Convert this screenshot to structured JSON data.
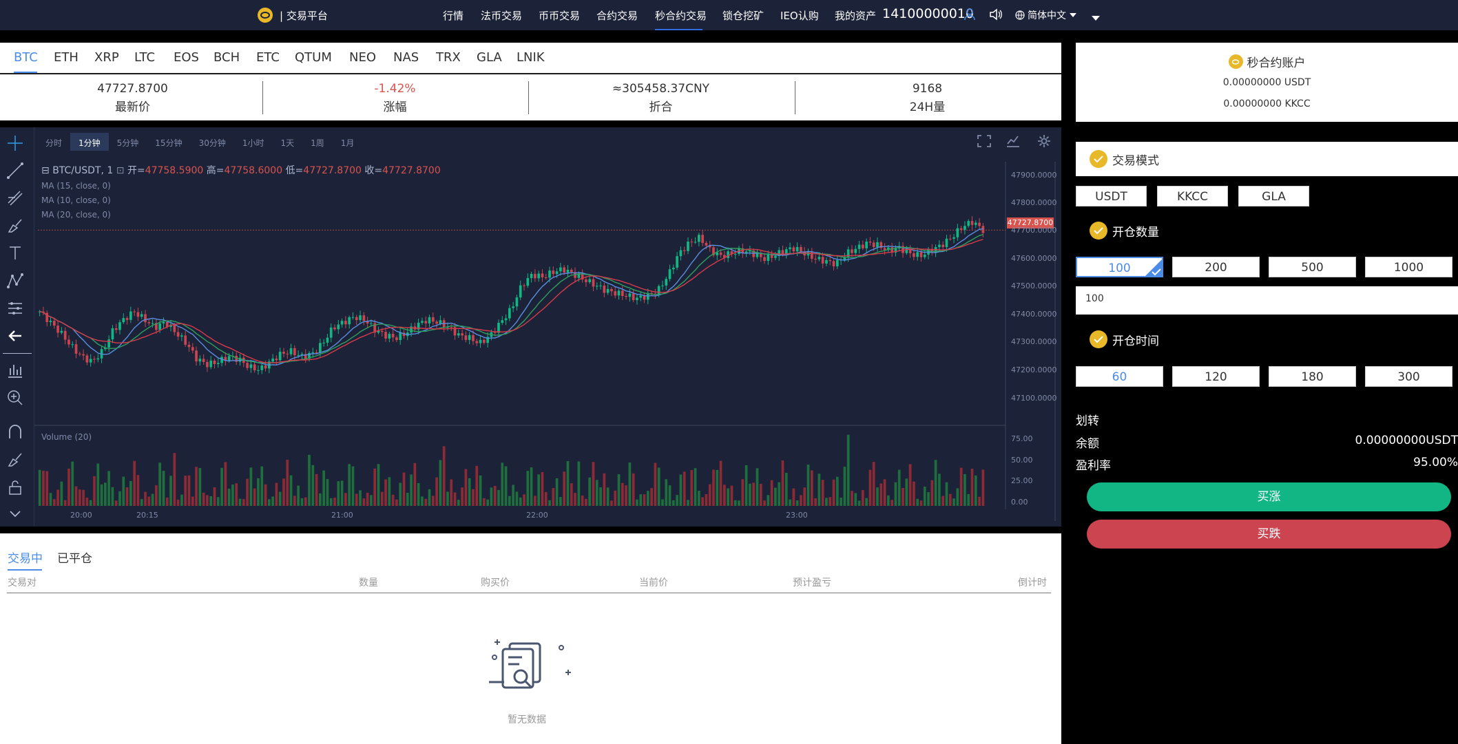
{
  "nav": {
    "brand": "| 交易平台",
    "items": [
      "行情",
      "法币交易",
      "币币交易",
      "合约交易",
      "秒合约交易",
      "锁仓挖矿",
      "IEO认购",
      "我的资产"
    ],
    "active": "秒合约交易",
    "account": "14100000010",
    "language": "简体中文"
  },
  "coins": {
    "tabs": [
      "BTC",
      "ETH",
      "XRP",
      "LTC",
      "EOS",
      "BCH",
      "ETC",
      "QTUM",
      "NEO",
      "NAS",
      "TRX",
      "GLA",
      "LNIK"
    ],
    "active": "BTC"
  },
  "stats": [
    {
      "value": "47727.8700",
      "label": "最新价"
    },
    {
      "value": "-1.42%",
      "label": "涨幅"
    },
    {
      "value": "≈305458.37CNY",
      "label": "折合"
    },
    {
      "value": "9168",
      "label": "24H量"
    }
  ],
  "chart": {
    "intervals": [
      "分时",
      "1分钟",
      "5分钟",
      "15分钟",
      "30分钟",
      "1小时",
      "1天",
      "1周",
      "1月"
    ],
    "active_interval": "1分钟",
    "symbol": "BTC/USDT, 1",
    "open_label": "开=",
    "open": "47758.5900",
    "high_label": "高=",
    "high": "47758.6000",
    "low_label": "低=",
    "low": "47727.8700",
    "close_label": "收=",
    "close": "47727.8700",
    "ma": [
      "MA (15, close, 0)",
      "MA (10, close, 0)",
      "MA (20, close, 0)"
    ],
    "volume_label": "Volume (20)",
    "last_price_tag": "47727.8700",
    "price_ticks": [
      "47900.0000",
      "47800.0000",
      "47700.0000",
      "47600.0000",
      "47500.0000",
      "47400.0000",
      "47300.0000",
      "47200.0000",
      "47100.0000"
    ],
    "volume_ticks": [
      "75.00",
      "50.00",
      "25.00",
      "0.00"
    ],
    "time_ticks": [
      "20:00",
      "20:15",
      "21:00",
      "22:00",
      "23:00"
    ]
  },
  "chart_data": {
    "type": "candlestick",
    "title": "BTC/USDT, 1",
    "ylim": [
      47050,
      47960
    ],
    "x_labels": [
      "20:00",
      "20:15",
      "21:00",
      "22:00",
      "23:00"
    ],
    "close_series": [
      47420,
      47380,
      47340,
      47290,
      47250,
      47230,
      47270,
      47350,
      47390,
      47420,
      47390,
      47360,
      47380,
      47340,
      47300,
      47240,
      47220,
      47230,
      47250,
      47240,
      47210,
      47200,
      47230,
      47260,
      47270,
      47250,
      47260,
      47300,
      47360,
      47380,
      47400,
      47390,
      47350,
      47330,
      47320,
      47340,
      47370,
      47390,
      47380,
      47360,
      47330,
      47320,
      47300,
      47330,
      47380,
      47430,
      47520,
      47560,
      47550,
      47570,
      47580,
      47560,
      47540,
      47520,
      47500,
      47490,
      47480,
      47470,
      47480,
      47500,
      47560,
      47640,
      47680,
      47700,
      47650,
      47630,
      47640,
      47650,
      47640,
      47620,
      47630,
      47650,
      47660,
      47640,
      47620,
      47610,
      47600,
      47640,
      47660,
      47680,
      47670,
      47650,
      47660,
      47640,
      47630,
      47650,
      47670,
      47700,
      47740,
      47760,
      47727.87
    ],
    "volume_max": 75
  },
  "orders": {
    "tabs": [
      "交易中",
      "已平仓"
    ],
    "active": "交易中",
    "columns": [
      "交易对",
      "数量",
      "购买价",
      "当前价",
      "预计盈亏",
      "倒计时"
    ],
    "empty": "暂无数据"
  },
  "side": {
    "account_title": "秒合约账户",
    "usdt_balance": "0.00000000 USDT",
    "kkcc_balance": "0.00000000 KKCC",
    "mode_title": "交易模式",
    "modes": [
      "USDT",
      "KKCC",
      "GLA"
    ],
    "qty_title": "开仓数量",
    "quantities": [
      "100",
      "200",
      "500",
      "1000"
    ],
    "qty_selected": "100",
    "qty_value": "100",
    "time_title": "开仓时间",
    "times": [
      "60",
      "120",
      "180",
      "300"
    ],
    "time_selected": "60",
    "transfer": "划转",
    "balance_label": "余额",
    "balance_value": "0.00000000USDT",
    "profit_label": "盈利率",
    "profit_value": "95.00%",
    "buy_up": "买涨",
    "buy_down": "买跌"
  },
  "colors": {
    "up": "#11b684",
    "down": "#cc4450",
    "accent": "#4a8ce8",
    "gold": "#e9b828",
    "nav_bg": "#1c2338"
  }
}
